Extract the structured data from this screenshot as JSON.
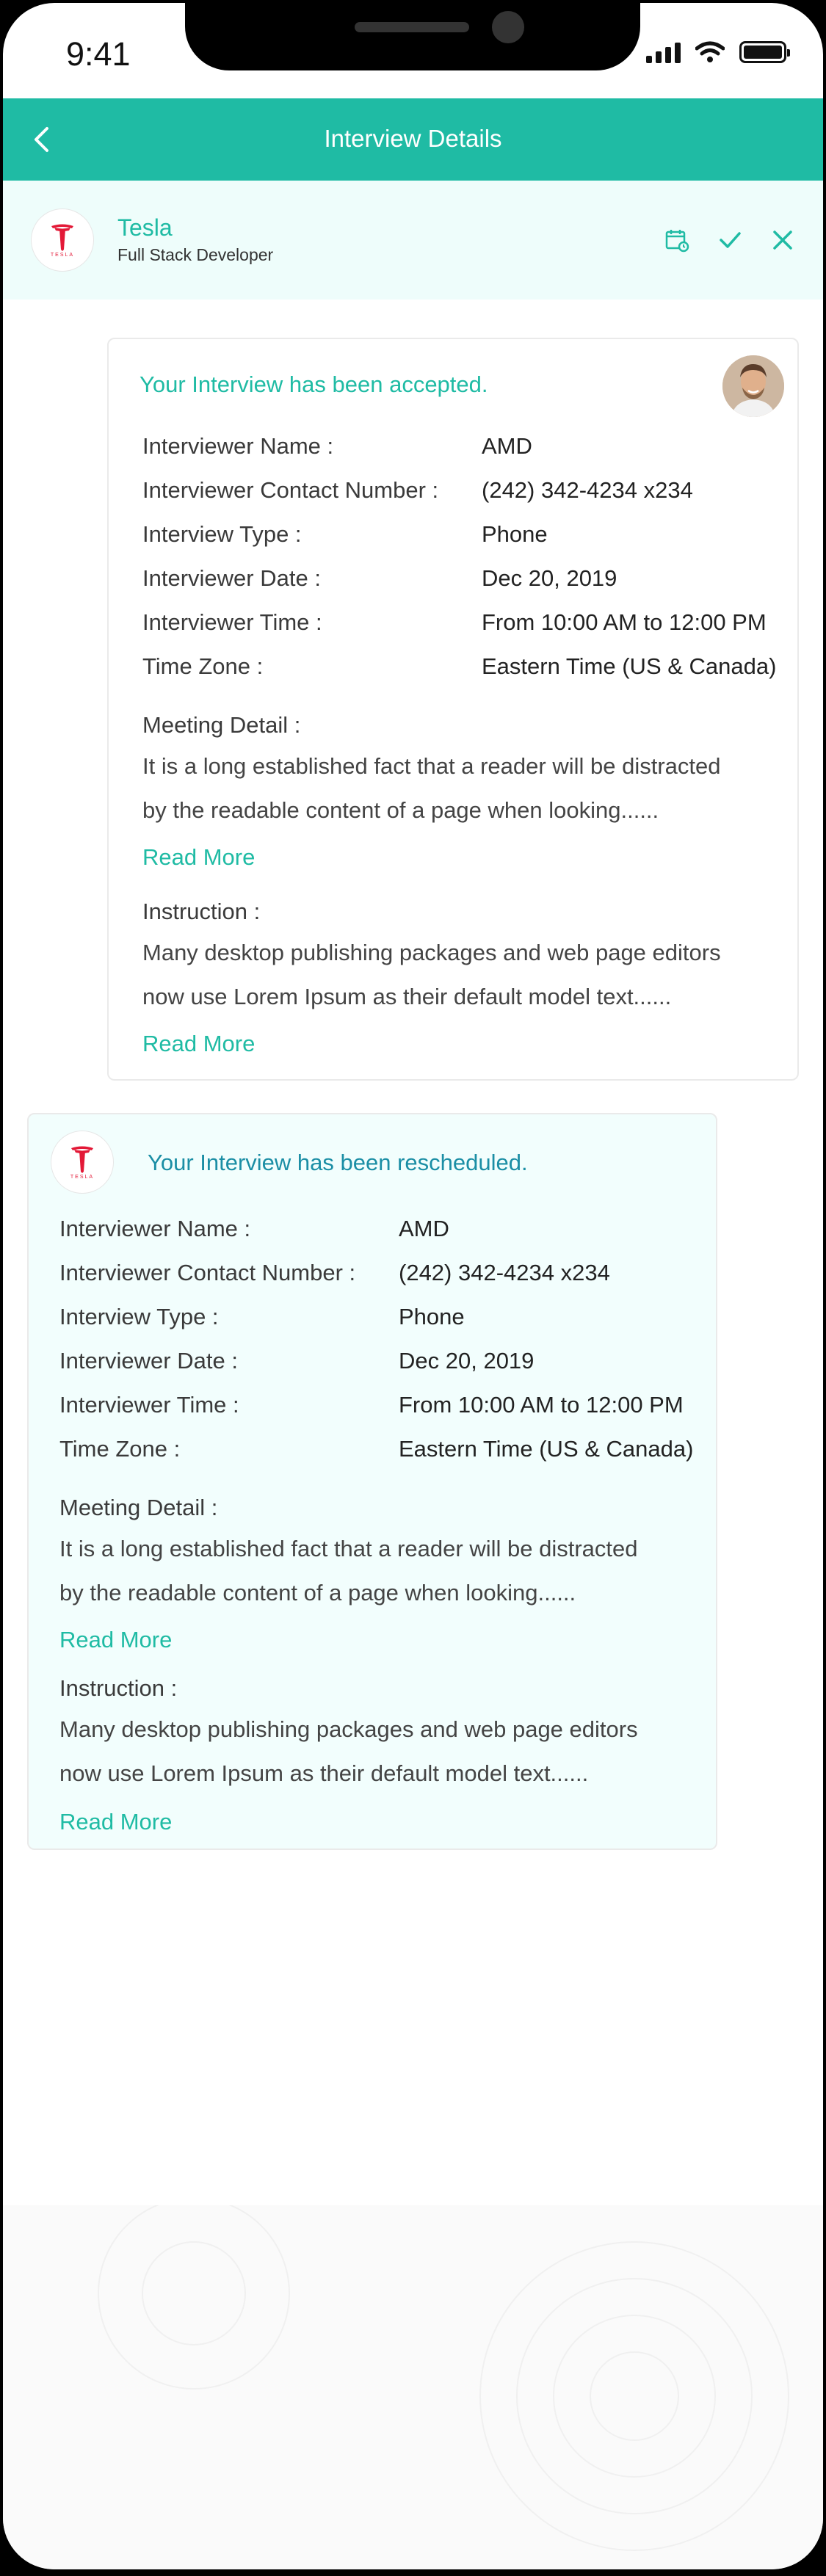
{
  "status_bar": {
    "time": "9:41"
  },
  "header": {
    "title": "Interview Details"
  },
  "company": {
    "name": "Tesla",
    "role": "Full Stack Developer",
    "logo_text": "TESLA"
  },
  "card_accepted": {
    "heading": "Your Interview has been accepted.",
    "fields": [
      {
        "label": "Interviewer Name :",
        "value": "AMD"
      },
      {
        "label": "Interviewer Contact Number :",
        "value": "(242) 342-4234 x234"
      },
      {
        "label": "Interview Type :",
        "value": "Phone"
      },
      {
        "label": "Interviewer Date :",
        "value": "Dec 20, 2019"
      },
      {
        "label": "Interviewer Time :",
        "value": "From 10:00 AM to 12:00 PM"
      },
      {
        "label": "Time Zone :",
        "value": "Eastern Time (US & Canada)"
      }
    ],
    "meeting_label": "Meeting Detail :",
    "meeting_line1": "It is a long established fact that a reader will be distracted",
    "meeting_line2": "by the readable content of a page when looking......",
    "read_more": "Read More",
    "instruction_label": "Instruction :",
    "instruction_line1": "Many desktop publishing packages and web page editors",
    "instruction_line2": "now use Lorem Ipsum as their default model text......"
  },
  "card_rescheduled": {
    "heading": "Your Interview has been rescheduled.",
    "fields": [
      {
        "label": "Interviewer Name :",
        "value": "AMD"
      },
      {
        "label": "Interviewer Contact Number :",
        "value": "(242) 342-4234 x234"
      },
      {
        "label": "Interview Type :",
        "value": "Phone"
      },
      {
        "label": "Interviewer Date :",
        "value": "Dec 20, 2019"
      },
      {
        "label": "Interviewer Time :",
        "value": "From 10:00 AM to 12:00 PM"
      },
      {
        "label": "Time Zone :",
        "value": "Eastern Time (US & Canada)"
      }
    ],
    "meeting_label": "Meeting Detail :",
    "meeting_line1": "It is a long established fact that a reader will be distracted",
    "meeting_line2": "by the readable content of a page when looking......",
    "read_more": "Read More",
    "instruction_label": "Instruction :",
    "instruction_line1": "Many desktop publishing packages and web page editors",
    "instruction_line2": "now use Lorem Ipsum as their default model text......"
  },
  "colors": {
    "accent": "#1fbba4",
    "accent_dark": "#1b8ea5",
    "light_bg": "#eefdfb",
    "tesla_red": "#e31937"
  },
  "icons": [
    "back-arrow-icon",
    "calendar-icon",
    "check-icon",
    "close-icon",
    "tesla-logo-icon",
    "signal-icon",
    "wifi-icon",
    "battery-icon"
  ]
}
